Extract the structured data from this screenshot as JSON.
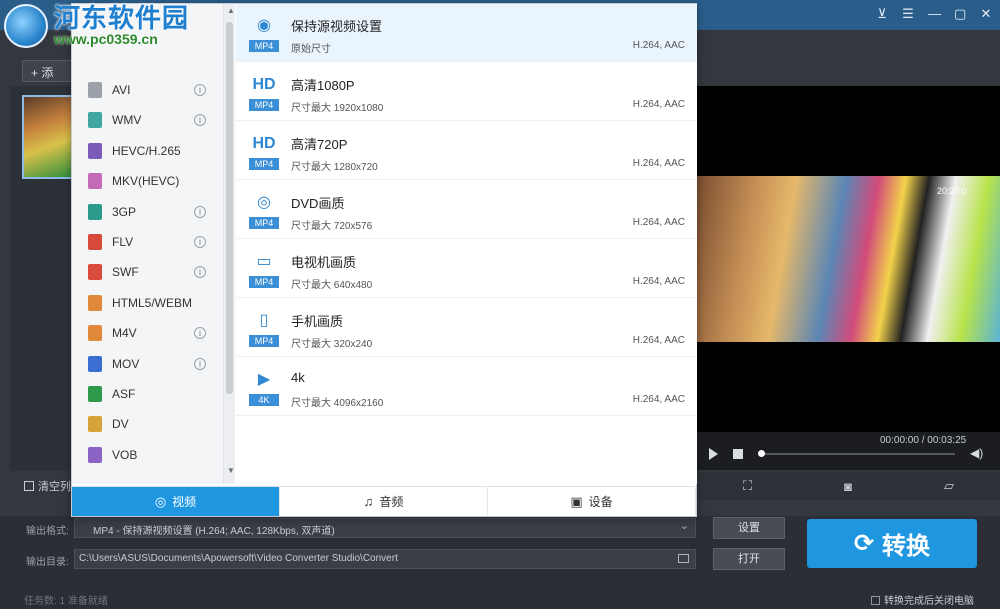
{
  "watermark": {
    "line1": "河东软件园",
    "line2": "www.pc0359.cn"
  },
  "window": {
    "controls": [
      "cart-icon",
      "menu-icon",
      "minimize-icon",
      "maximize-icon",
      "close-icon"
    ]
  },
  "toolbar": {
    "add_label": "+ 添"
  },
  "formats": [
    {
      "label": "AVI",
      "color": "#9aa1a9",
      "info": true
    },
    {
      "label": "WMV",
      "color": "#3fa7a0",
      "info": true
    },
    {
      "label": "HEVC/H.265",
      "color": "#7c5ab8",
      "info": false
    },
    {
      "label": "MKV(HEVC)",
      "color": "#c46ab6",
      "info": false
    },
    {
      "label": "3GP",
      "color": "#2a9a8a",
      "info": true
    },
    {
      "label": "FLV",
      "color": "#d84a3a",
      "info": true
    },
    {
      "label": "SWF",
      "color": "#d84a3a",
      "info": true
    },
    {
      "label": "HTML5/WEBM",
      "color": "#e0893a",
      "info": false
    },
    {
      "label": "M4V",
      "color": "#e0893a",
      "info": true
    },
    {
      "label": "MOV",
      "color": "#3b6fd1",
      "info": true
    },
    {
      "label": "ASF",
      "color": "#2f9a4a",
      "info": false
    },
    {
      "label": "DV",
      "color": "#d8a23a",
      "info": false
    },
    {
      "label": "VOB",
      "color": "#8a63c4",
      "info": false
    }
  ],
  "info_glyph": "i",
  "presets": [
    {
      "glyph": "◉",
      "tag": "MP4",
      "title": "保持源视频设置",
      "sub": "原始尺寸",
      "codec": "H.264, AAC",
      "selected": true
    },
    {
      "glyph": "HD",
      "tag": "MP4",
      "title": "高清1080P",
      "sub": "尺寸最大  1920x1080",
      "codec": "H.264, AAC",
      "selected": false
    },
    {
      "glyph": "HD",
      "tag": "MP4",
      "title": "高清720P",
      "sub": "尺寸最大  1280x720",
      "codec": "H.264, AAC",
      "selected": false
    },
    {
      "glyph": "◎",
      "tag": "MP4",
      "title": "DVD画质",
      "sub": "尺寸最大  720x576",
      "codec": "H.264, AAC",
      "selected": false
    },
    {
      "glyph": "▭",
      "tag": "MP4",
      "title": "电视机画质",
      "sub": "尺寸最大  640x480",
      "codec": "H.264, AAC",
      "selected": false
    },
    {
      "glyph": "▯",
      "tag": "MP4",
      "title": "手机画质",
      "sub": "尺寸最大  320x240",
      "codec": "H.264, AAC",
      "selected": false
    },
    {
      "glyph": "▶",
      "tag": "4K",
      "title": "4k",
      "sub": "尺寸最大  4096x2160",
      "codec": "H.264, AAC",
      "selected": false
    }
  ],
  "tabs": [
    {
      "label": "视频",
      "icon": "◎",
      "active": true
    },
    {
      "label": "音频",
      "icon": "♫",
      "active": false
    },
    {
      "label": "设备",
      "icon": "▣",
      "active": false
    }
  ],
  "player": {
    "time": "00:00:00 / 00:03:25",
    "video_time_tag": "20:29:0"
  },
  "list": {
    "clear_label": "清空列"
  },
  "output": {
    "format_label": "输出格式:",
    "format_value": "MP4 - 保持源视频设置 (H.264; AAC, 128Kbps, 双声道)",
    "dir_label": "输出目录:",
    "dir_value": "C:\\Users\\ASUS\\Documents\\Apowersoft\\Video Converter Studio\\Convert",
    "settings_button": "设置",
    "open_button": "打开",
    "convert_button": "转换"
  },
  "status": {
    "task_text": "任务数: 1    准备就绪",
    "shutdown_label": "转换完成后关闭电脑"
  }
}
